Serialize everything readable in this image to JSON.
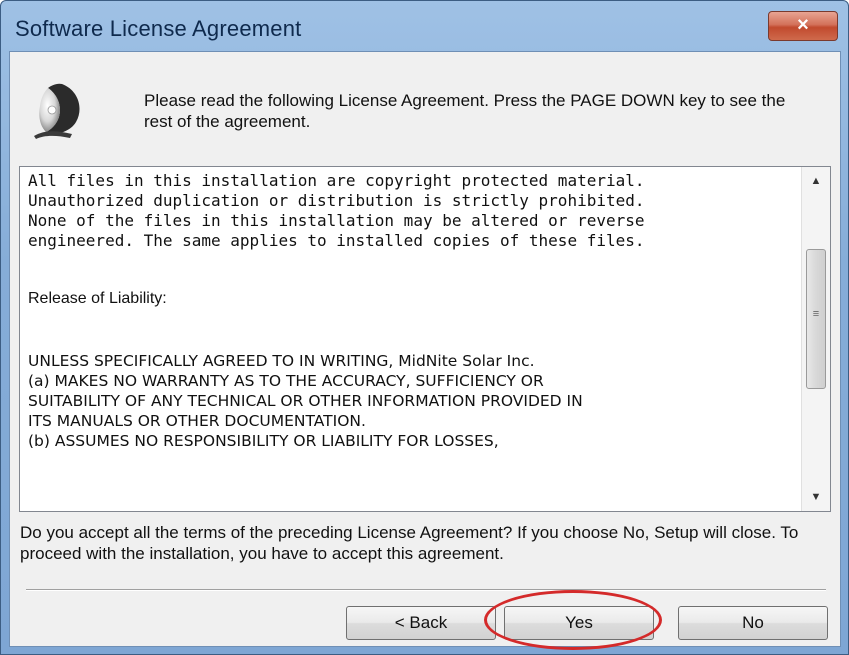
{
  "window": {
    "title": "Software License Agreement",
    "close_label": "×"
  },
  "header": {
    "icon": "installer-disc-icon",
    "text": "Please read the following License Agreement. Press the PAGE DOWN key to see the rest of the agreement."
  },
  "license": {
    "intro": "All files in this installation are copyright protected material.\nUnauthorized duplication or distribution is strictly prohibited.\nNone of the files in this installation may be altered or reverse\nengineered. The same applies to installed copies of these files.",
    "release_heading": "Release of Liability:",
    "body": "UNLESS SPECIFICALLY AGREED TO IN WRITING, MidNite Solar Inc.\n(a) MAKES NO WARRANTY AS TO THE ACCURACY, SUFFICIENCY OR\nSUITABILITY OF ANY TECHNICAL OR OTHER INFORMATION PROVIDED IN\nITS MANUALS OR OTHER DOCUMENTATION.\n(b) ASSUMES NO RESPONSIBILITY OR LIABILITY FOR LOSSES,"
  },
  "scrollbar": {
    "up_arrow": "▲",
    "down_arrow": "▼",
    "thumb_grip": "≡"
  },
  "prompt": {
    "text": "Do you accept all the terms of the preceding License Agreement? If you choose No, Setup will close. To proceed with the installation, you have to accept this agreement."
  },
  "buttons": {
    "back": "< Back",
    "yes": "Yes",
    "no": "No"
  },
  "colors": {
    "annotation": "#d42a2a",
    "titlebar": "#86add8"
  }
}
